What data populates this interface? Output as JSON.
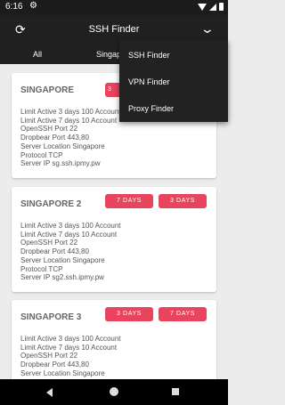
{
  "status": {
    "time": "6:16",
    "gear_glyph": "⚙"
  },
  "appbar": {
    "title": "SSH Finder",
    "refresh_glyph": "⟳",
    "menu_glyph": "⌄"
  },
  "tabs": [
    "All",
    "Singapo"
  ],
  "menu": {
    "items": [
      "SSH Finder",
      "VPN Finder",
      "Proxy Finder"
    ]
  },
  "servers": [
    {
      "name": "SINGAPORE",
      "buttons": [
        "3"
      ],
      "lines": [
        "Limit Active 3 days 100 Account",
        "Limit Active 7 days 10 Account",
        "OpenSSH Port 22",
        "Dropbear Port 443,80",
        "Server Location Singapore",
        "Protocol TCP",
        "Server IP sg.ssh.ipmy.pw"
      ]
    },
    {
      "name": "SINGAPORE 2",
      "buttons": [
        "7 DAYS",
        "3 DAYS"
      ],
      "lines": [
        "Limit Active 3 days 100 Account",
        "Limit Active 7 days 10 Account",
        "OpenSSH Port 22",
        "Dropbear Port 443,80",
        "Server Location Singapore",
        "Protocol TCP",
        "Server IP sg2.ssh.ipmy.pw"
      ]
    },
    {
      "name": "SINGAPORE 3",
      "buttons": [
        "3 DAYS",
        "7 DAYS"
      ],
      "lines": [
        "Limit Active 3 days 100 Account",
        "Limit Active 7 days 10 Account",
        "OpenSSH Port 22",
        "Dropbear Port 443,80",
        "Server Location Singapore"
      ]
    }
  ],
  "colors": {
    "accent": "#e8445e",
    "appbar": "#202020",
    "background": "#ececec"
  }
}
